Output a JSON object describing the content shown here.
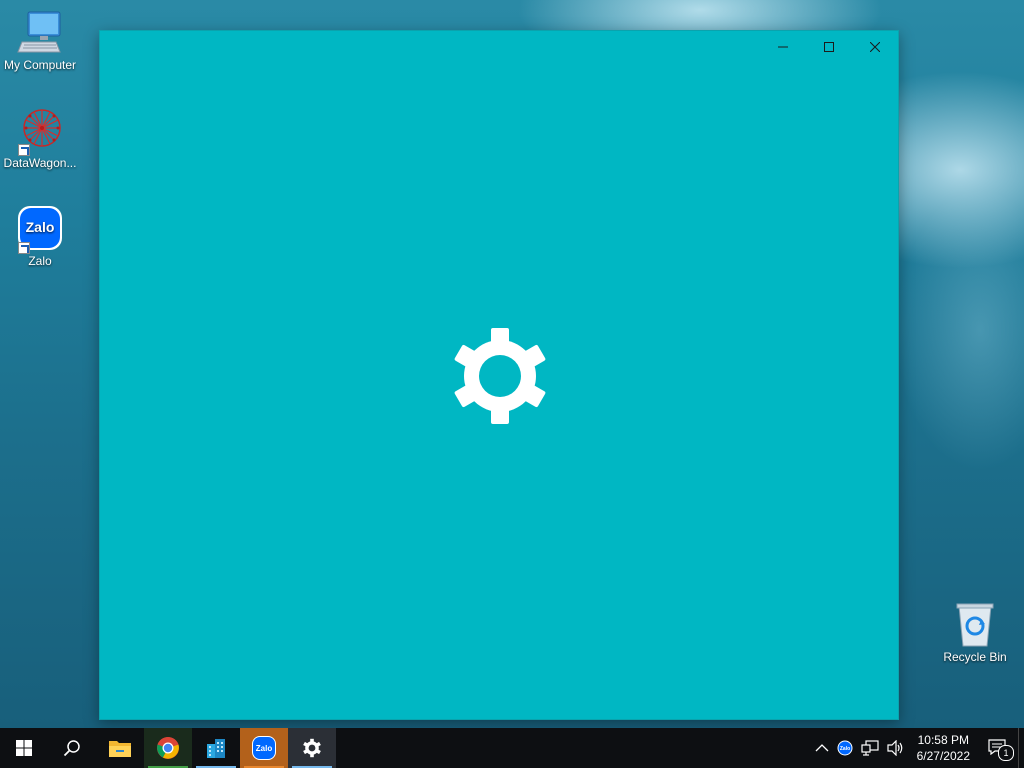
{
  "desktop": {
    "icons": [
      {
        "label": "My Computer",
        "icon": "computer-icon"
      },
      {
        "label": "DataWagon...",
        "icon": "datawagon-icon"
      },
      {
        "label": "Zalo",
        "icon": "zalo-icon",
        "logo_text": "Zalo"
      },
      {
        "label": "Recycle Bin",
        "icon": "recycle-bin-icon"
      }
    ]
  },
  "window": {
    "background": "#00b7c3",
    "controls": [
      "minimize-icon",
      "maximize-icon",
      "close-icon"
    ],
    "splash_icon": "gear-icon"
  },
  "taskbar": {
    "buttons": [
      {
        "name": "start",
        "icon": "windows-logo-icon"
      },
      {
        "name": "search",
        "icon": "search-icon"
      },
      {
        "name": "file-explorer",
        "icon": "folder-icon"
      },
      {
        "name": "chrome",
        "icon": "chrome-icon"
      },
      {
        "name": "app",
        "icon": "buildings-icon"
      },
      {
        "name": "zalo",
        "icon": "zalo-icon",
        "logo_text": "Zalo"
      },
      {
        "name": "settings",
        "icon": "gear-icon"
      }
    ],
    "tray": {
      "time": "10:58 PM",
      "date": "6/27/2022",
      "notification_count": "1"
    }
  },
  "colors": {
    "accent": "#00b7c3",
    "taskbar": "#0d0f12",
    "running_indicator": "#76b9ed"
  }
}
